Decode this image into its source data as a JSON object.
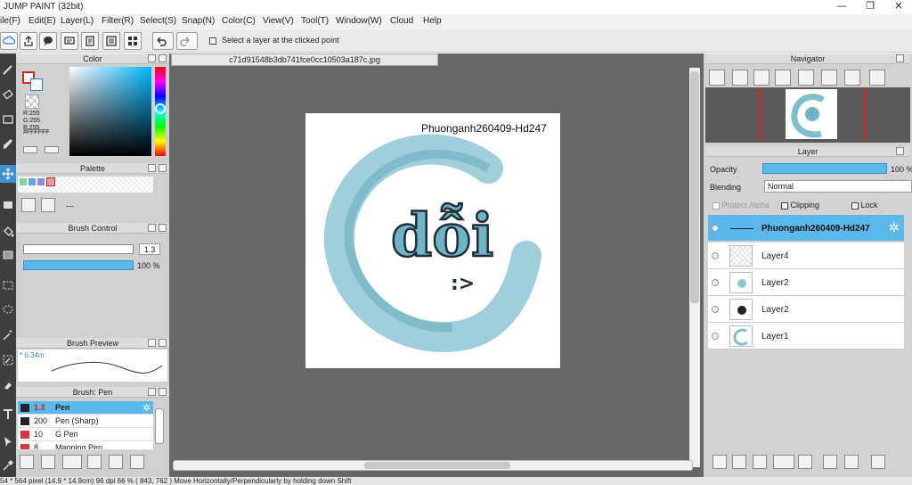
{
  "window": {
    "title": "JUMP PAINT (32bit)",
    "minimize": "—",
    "restore": "❐",
    "close": "✕"
  },
  "menu": [
    "ile(F)",
    "Edit(E)",
    "Layer(L)",
    "Filter(R)",
    "Select(S)",
    "Snap(N)",
    "Color(C)",
    "View(V)",
    "Tool(T)",
    "Window(W)",
    "Cloud",
    "Help"
  ],
  "toolbar": {
    "select_layer_label": "Select a layer at the clicked point"
  },
  "color_panel": {
    "title": "Color",
    "r": "R:255",
    "g": "G:255",
    "b": "B:255",
    "hex": "#FFFFFF"
  },
  "palette_panel": {
    "title": "Palette",
    "dash": "---",
    "swatches": [
      "#7bd88f",
      "#6aa0e8",
      "#8a8adf",
      "#e0a0a0"
    ]
  },
  "brush_control": {
    "title": "Brush Control",
    "size": "1.3",
    "opacity": "100 %"
  },
  "brush_preview": {
    "title": "Brush Preview",
    "size_label": "* 0.34m"
  },
  "brush_list": {
    "title": "Brush: Pen",
    "items": [
      {
        "size": "1.3",
        "name": "Pen",
        "color": "#222222"
      },
      {
        "size": "200",
        "name": "Pen (Sharp)",
        "color": "#222222"
      },
      {
        "size": "10",
        "name": "G Pen",
        "color": "#d33"
      },
      {
        "size": "8",
        "name": "Mapping Pen",
        "color": "#d33"
      }
    ]
  },
  "document": {
    "tab": "c71d91548b3db741fce0cc10503a187c.jpg",
    "canvas_text": "Phuonganh260409-Hd247",
    "logo_text": "dỗi",
    "emoticon": ":>"
  },
  "navigator": {
    "title": "Navigator"
  },
  "layer_panel": {
    "title": "Layer",
    "opacity_label": "Opacity",
    "opacity_value": "100 %",
    "blending_label": "Blending",
    "blending_value": "Normal",
    "protect_alpha": "Protect Alpha",
    "clipping": "Clipping",
    "lock": "Lock",
    "layers": [
      {
        "name": "Phuonganh260409-Hd247",
        "selected": true
      },
      {
        "name": "Layer4",
        "selected": false
      },
      {
        "name": "Layer2",
        "selected": false
      },
      {
        "name": "Layer2",
        "selected": false
      },
      {
        "name": "Layer1",
        "selected": false
      }
    ]
  },
  "status": {
    "text": "54 * 564 pixel   (14.9 * 14.9cm)   96 dpi   66 %   ( 843, 762 )   Move Horizontally/Perpendicularly by holding down Shift"
  },
  "colors": {
    "accent": "#5bb8ea",
    "dark_panel": "#3e3e3e",
    "canvas_bg": "#676767",
    "logo_teal": "#6fb3c4"
  }
}
